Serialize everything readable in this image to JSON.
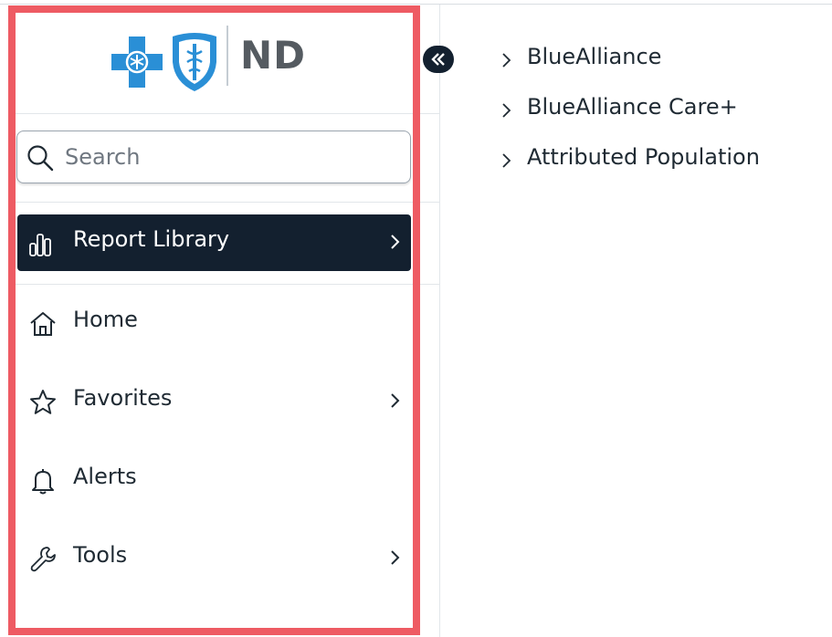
{
  "brand": {
    "logo_text": "ND",
    "accent_color": "#2a8fd6",
    "dark_color": "#13202f",
    "highlight_color": "#ee5b63"
  },
  "search": {
    "placeholder": "Search",
    "value": ""
  },
  "nav": {
    "items": [
      {
        "label": "Report Library",
        "icon": "bar-chart-icon",
        "active": true,
        "has_submenu": true
      },
      {
        "label": "Home",
        "icon": "home-icon",
        "active": false,
        "has_submenu": false
      },
      {
        "label": "Favorites",
        "icon": "star-icon",
        "active": false,
        "has_submenu": true
      },
      {
        "label": "Alerts",
        "icon": "bell-icon",
        "active": false,
        "has_submenu": false
      },
      {
        "label": "Tools",
        "icon": "wrench-icon",
        "active": false,
        "has_submenu": true
      }
    ]
  },
  "collapse_button": {
    "icon": "double-chevron-left-icon"
  },
  "report_tree": {
    "items": [
      {
        "label": "BlueAlliance"
      },
      {
        "label": "BlueAlliance Care+"
      },
      {
        "label": "Attributed Population"
      }
    ]
  }
}
